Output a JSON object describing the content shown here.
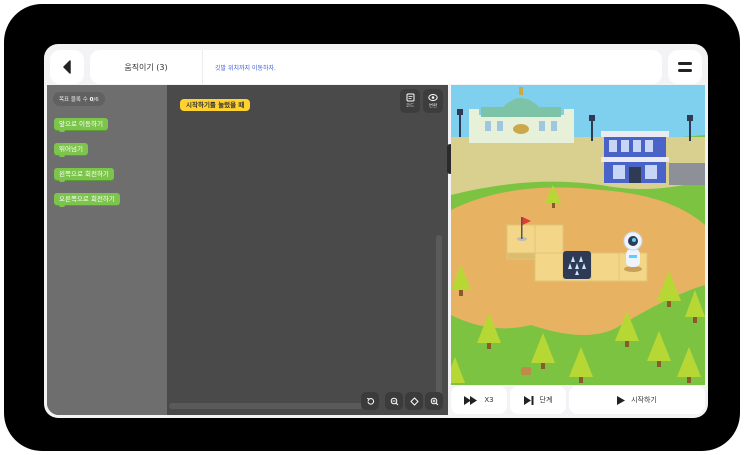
{
  "header": {
    "title": "움직이기 (3)",
    "goal": "깃발 위치까지 이동하자."
  },
  "palette": {
    "count_label": "목표 블록 수",
    "count_value": "0",
    "count_total": "/6",
    "blocks": [
      "앞으로 이동하기",
      "뛰어넘기",
      "왼쪽으로 회전하기",
      "오른쪽으로 회전하기"
    ]
  },
  "workspace": {
    "start_block": "시작하기를 눌렀을 때",
    "code_label": "코드",
    "view_label": "변환"
  },
  "controls": {
    "speed_label": "X3",
    "step_label": "단계",
    "start_label": "시작하기"
  },
  "colors": {
    "block_green": "#7cc44b",
    "start_yellow": "#ffd22e",
    "editor_dark": "#4a4a4a",
    "palette_gray": "#6e6e6e"
  }
}
